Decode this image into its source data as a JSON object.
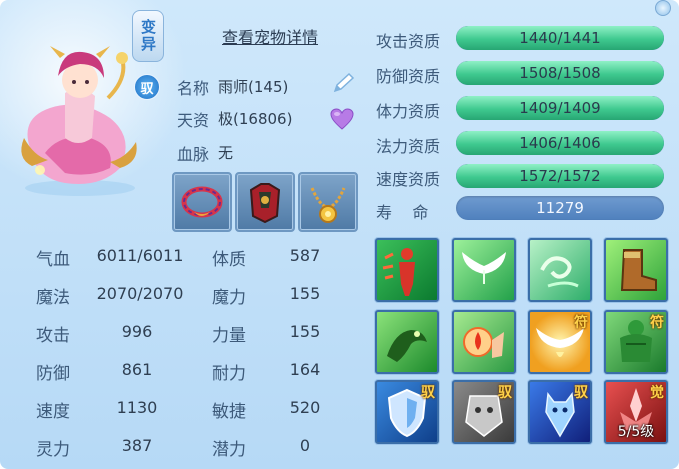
{
  "header": {
    "variant_badge": "变异",
    "tame_badge": "驭",
    "view_detail": "查看宠物详情"
  },
  "info": {
    "name_label": "名称",
    "name_value": "雨师(145)",
    "talent_label": "天资",
    "talent_value": "极(16806)",
    "bloodline_label": "血脉",
    "bloodline_value": "无"
  },
  "stats": [
    {
      "label": "气血",
      "value": "6011/6011"
    },
    {
      "label": "魔法",
      "value": "2070/2070"
    },
    {
      "label": "攻击",
      "value": "996"
    },
    {
      "label": "防御",
      "value": "861"
    },
    {
      "label": "速度",
      "value": "1130"
    },
    {
      "label": "灵力",
      "value": "387"
    }
  ],
  "attributes": [
    {
      "label": "体质",
      "value": "587"
    },
    {
      "label": "魔力",
      "value": "155"
    },
    {
      "label": "力量",
      "value": "155"
    },
    {
      "label": "耐力",
      "value": "164"
    },
    {
      "label": "敏捷",
      "value": "520"
    },
    {
      "label": "潜力",
      "value": "0"
    }
  ],
  "aptitudes": [
    {
      "label": "攻击资质",
      "value": "1440/1441",
      "fill": 0.999
    },
    {
      "label": "防御资质",
      "value": "1508/1508",
      "fill": 1.0
    },
    {
      "label": "体力资质",
      "value": "1409/1409",
      "fill": 1.0
    },
    {
      "label": "法力资质",
      "value": "1406/1406",
      "fill": 1.0
    },
    {
      "label": "速度资质",
      "value": "1572/1572",
      "fill": 1.0
    }
  ],
  "lifespan": {
    "label": "寿    命",
    "value": "11279"
  },
  "skills": {
    "fu_tag": "符",
    "yu_tag": "驭",
    "jue_tag": "觉",
    "level_text": "5/5级"
  },
  "colors": {
    "accent_blue": "#2e78c6",
    "bar_green": "#3fc98f",
    "tag_gold": "#ffd24a"
  }
}
